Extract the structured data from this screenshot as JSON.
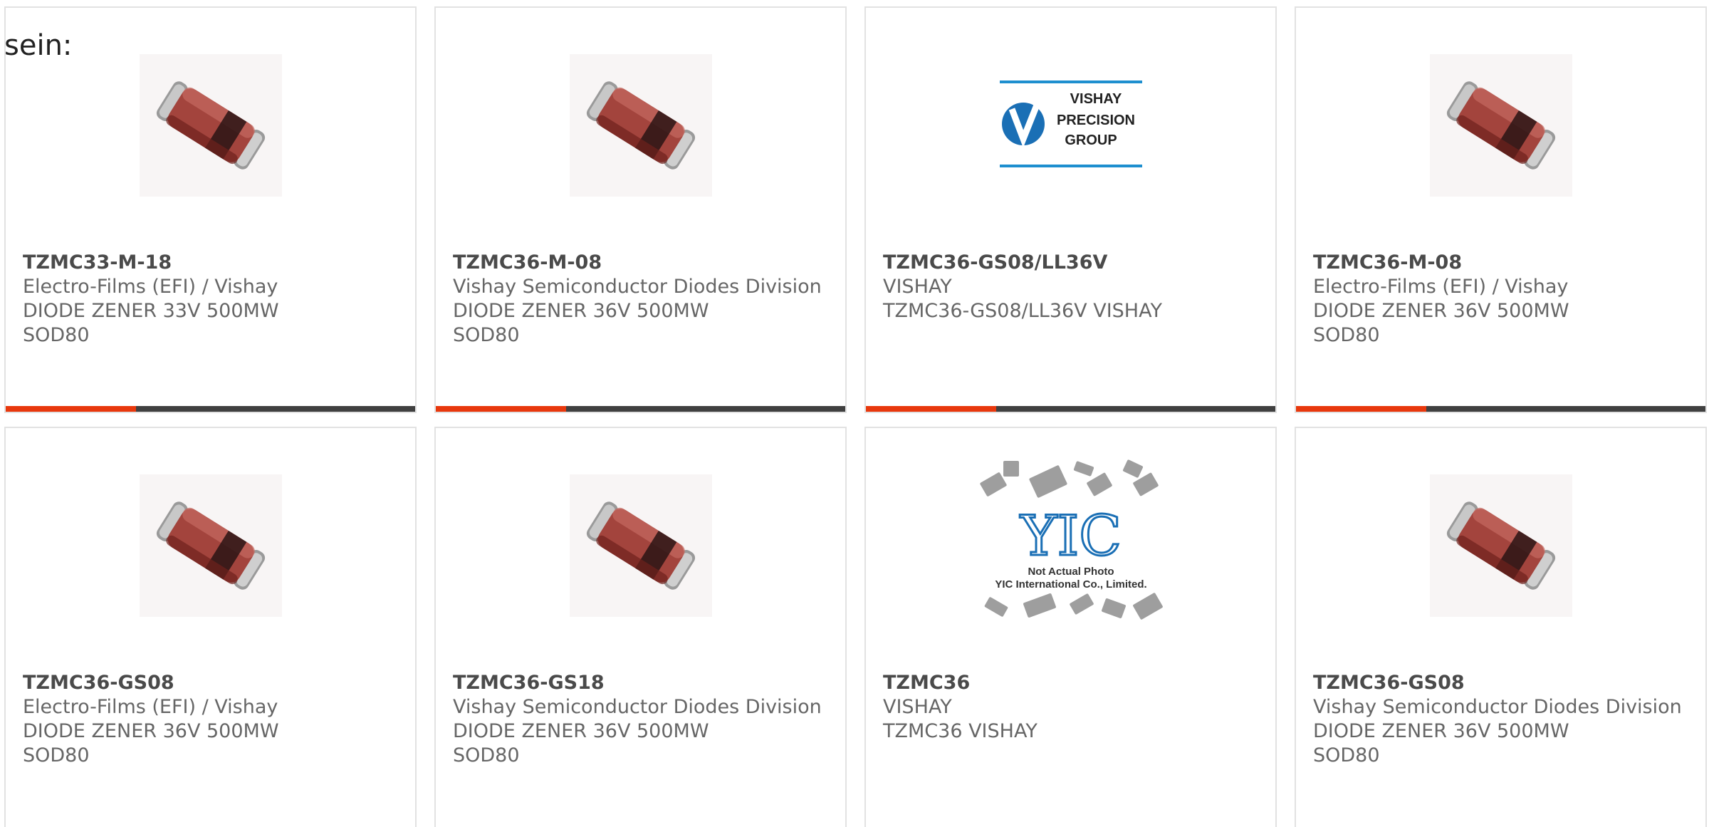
{
  "intro": "sein:",
  "accent_color": "#e8380d",
  "bar_color": "#404040",
  "cards": [
    {
      "part": "TZMC33-M-18",
      "maker": "Electro-Films (EFI) / Vishay",
      "desc": "DIODE ZENER 33V 500MW",
      "pkg": "SOD80",
      "image": "diode-photo"
    },
    {
      "part": "TZMC36-M-08",
      "maker": "Vishay Semiconductor Diodes Division",
      "desc": "DIODE ZENER 36V 500MW",
      "pkg": "SOD80",
      "image": "diode-photo"
    },
    {
      "part": "TZMC36-GS08/LL36V",
      "maker": "VISHAY",
      "desc": "TZMC36-GS08/LL36V VISHAY",
      "pkg": "",
      "image": "vishay-logo",
      "logo_lines": [
        "VISHAY",
        "PRECISION",
        "GROUP"
      ]
    },
    {
      "part": "TZMC36-M-08",
      "maker": "Electro-Films (EFI) / Vishay",
      "desc": "DIODE ZENER 36V 500MW",
      "pkg": "SOD80",
      "image": "diode-photo"
    },
    {
      "part": "TZMC36-GS08",
      "maker": "Electro-Films (EFI) / Vishay",
      "desc": "DIODE ZENER 36V 500MW",
      "pkg": "SOD80",
      "image": "diode-photo"
    },
    {
      "part": "TZMC36-GS18",
      "maker": "Vishay Semiconductor Diodes Division",
      "desc": "DIODE ZENER 36V 500MW",
      "pkg": "SOD80",
      "image": "diode-photo"
    },
    {
      "part": "TZMC36",
      "maker": "VISHAY",
      "desc": "TZMC36 VISHAY",
      "pkg": "",
      "image": "yic-placeholder",
      "placeholder_lines": [
        "YIC",
        "Not Actual Photo",
        "YIC International Co., Limited."
      ]
    },
    {
      "part": "TZMC36-GS08",
      "maker": "Vishay Semiconductor Diodes Division",
      "desc": "DIODE ZENER 36V 500MW",
      "pkg": "SOD80",
      "image": "diode-photo"
    }
  ]
}
